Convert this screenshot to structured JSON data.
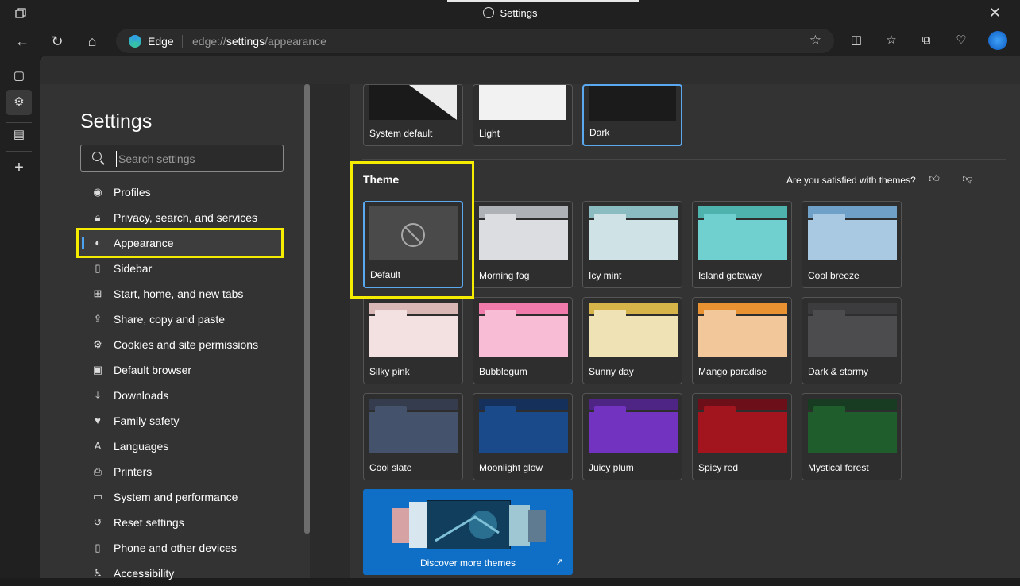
{
  "window": {
    "title": "Settings",
    "close_glyph": "✕"
  },
  "address": {
    "browser_label": "Edge",
    "url_prefix": "edge://",
    "url_strong": "settings",
    "url_suffix": "/appearance"
  },
  "sidebar": {
    "title": "Settings",
    "search_placeholder": "Search settings",
    "items": [
      {
        "label": "Profiles",
        "icon": "profile-icon"
      },
      {
        "label": "Privacy, search, and services",
        "icon": "lock-icon"
      },
      {
        "label": "Appearance",
        "icon": "palette-icon"
      },
      {
        "label": "Sidebar",
        "icon": "sidebar-icon"
      },
      {
        "label": "Start, home, and new tabs",
        "icon": "home-tabs-icon"
      },
      {
        "label": "Share, copy and paste",
        "icon": "share-icon"
      },
      {
        "label": "Cookies and site permissions",
        "icon": "cookie-icon"
      },
      {
        "label": "Default browser",
        "icon": "browser-icon"
      },
      {
        "label": "Downloads",
        "icon": "download-icon"
      },
      {
        "label": "Family safety",
        "icon": "family-icon"
      },
      {
        "label": "Languages",
        "icon": "language-icon"
      },
      {
        "label": "Printers",
        "icon": "printer-icon"
      },
      {
        "label": "System and performance",
        "icon": "laptop-icon"
      },
      {
        "label": "Reset settings",
        "icon": "reset-icon"
      },
      {
        "label": "Phone and other devices",
        "icon": "phone-icon"
      },
      {
        "label": "Accessibility",
        "icon": "accessibility-icon"
      }
    ]
  },
  "appearance": {
    "options": [
      {
        "label": "System default"
      },
      {
        "label": "Light"
      },
      {
        "label": "Dark"
      }
    ]
  },
  "theme": {
    "heading": "Theme",
    "feedback_prompt": "Are you satisfied with themes?",
    "cards": [
      {
        "label": "Default"
      },
      {
        "label": "Morning fog",
        "back": "#aeb2b7",
        "front": "#dcdde0"
      },
      {
        "label": "Icy mint",
        "back": "#8bbcc2",
        "front": "#cfe3e7"
      },
      {
        "label": "Island getaway",
        "back": "#4fb3ad",
        "front": "#6fd0cf"
      },
      {
        "label": "Cool breeze",
        "back": "#6fa0c8",
        "front": "#a9c8e2"
      },
      {
        "label": "Silky pink",
        "back": "#d9b7b5",
        "front": "#f2e1e0"
      },
      {
        "label": "Bubblegum",
        "back": "#f17bab",
        "front": "#f8bcd5"
      },
      {
        "label": "Sunny day",
        "back": "#d7b44a",
        "front": "#efe2b5"
      },
      {
        "label": "Mango paradise",
        "back": "#e99231",
        "front": "#f2c89b"
      },
      {
        "label": "Dark & stormy",
        "back": "#3c3c3e",
        "front": "#4c4c4f"
      },
      {
        "label": "Cool slate",
        "back": "#343c4d",
        "front": "#44526b"
      },
      {
        "label": "Moonlight glow",
        "back": "#15305b",
        "front": "#1b4a8a"
      },
      {
        "label": "Juicy plum",
        "back": "#4e2484",
        "front": "#7233c0"
      },
      {
        "label": "Spicy red",
        "back": "#6d0f18",
        "front": "#a3151e"
      },
      {
        "label": "Mystical forest",
        "back": "#183c22",
        "front": "#1f5e2c"
      }
    ],
    "discover_label": "Discover more themes"
  }
}
